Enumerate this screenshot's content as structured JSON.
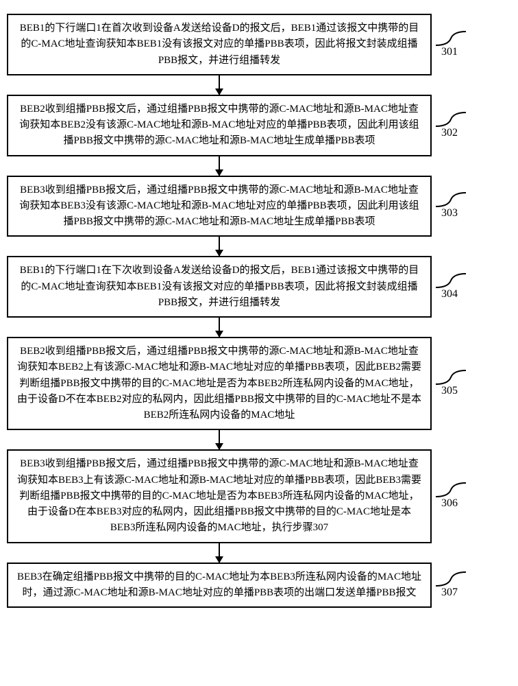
{
  "steps": [
    {
      "id": "301",
      "text": "BEB1的下行端口1在首次收到设备A发送给设备D的报文后，BEB1通过该报文中携带的目的C-MAC地址查询获知本BEB1没有该报文对应的单播PBB表项，因此将报文封装成组播PBB报文，并进行组播转发"
    },
    {
      "id": "302",
      "text": "BEB2收到组播PBB报文后，通过组播PBB报文中携带的源C-MAC地址和源B-MAC地址查询获知本BEB2没有该源C-MAC地址和源B-MAC地址对应的单播PBB表项，因此利用该组播PBB报文中携带的源C-MAC地址和源B-MAC地址生成单播PBB表项"
    },
    {
      "id": "303",
      "text": "BEB3收到组播PBB报文后，通过组播PBB报文中携带的源C-MAC地址和源B-MAC地址查询获知本BEB3没有该源C-MAC地址和源B-MAC地址对应的单播PBB表项，因此利用该组播PBB报文中携带的源C-MAC地址和源B-MAC地址生成单播PBB表项"
    },
    {
      "id": "304",
      "text": "BEB1的下行端口1在下次收到设备A发送给设备D的报文后，BEB1通过该报文中携带的目的C-MAC地址查询获知本BEB1没有该报文对应的单播PBB表项，因此将报文封装成组播PBB报文，并进行组播转发"
    },
    {
      "id": "305",
      "text": "BEB2收到组播PBB报文后，通过组播PBB报文中携带的源C-MAC地址和源B-MAC地址查询获知本BEB2上有该源C-MAC地址和源B-MAC地址对应的单播PBB表项，因此BEB2需要判断组播PBB报文中携带的目的C-MAC地址是否为本BEB2所连私网内设备的MAC地址，由于设备D不在本BEB2对应的私网内，因此组播PBB报文中携带的目的C-MAC地址不是本BEB2所连私网内设备的MAC地址"
    },
    {
      "id": "306",
      "text": "BEB3收到组播PBB报文后，通过组播PBB报文中携带的源C-MAC地址和源B-MAC地址查询获知本BEB3上有该源C-MAC地址和源B-MAC地址对应的单播PBB表项，因此BEB3需要判断组播PBB报文中携带的目的C-MAC地址是否为本BEB3所连私网内设备的MAC地址，由于设备D在本BEB3对应的私网内，因此组播PBB报文中携带的目的C-MAC地址是本BEB3所连私网内设备的MAC地址，执行步骤307"
    },
    {
      "id": "307",
      "text": "BEB3在确定组播PBB报文中携带的目的C-MAC地址为本BEB3所连私网内设备的MAC地址时，通过源C-MAC地址和源B-MAC地址对应的单播PBB表项的出端口发送单播PBB报文"
    }
  ]
}
